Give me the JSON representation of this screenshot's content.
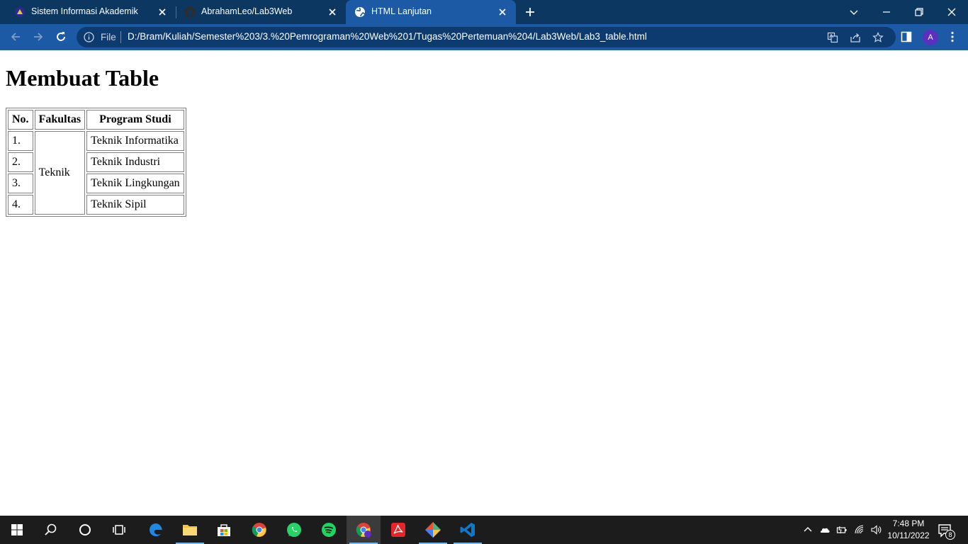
{
  "browser": {
    "tabs": [
      {
        "title": "Sistem Informasi Akademik",
        "active": false
      },
      {
        "title": "AbrahamLeo/Lab3Web",
        "active": false
      },
      {
        "title": "HTML Lanjutan",
        "active": true
      }
    ],
    "address": {
      "scheme_label": "File",
      "url": "D:/Bram/Kuliah/Semester%203/3.%20Pemrograman%20Web%201/Tugas%20Pertemuan%204/Lab3Web/Lab3_table.html"
    },
    "profile_initial": "A",
    "colors": {
      "tabstrip": "#0c3761",
      "toolbar": "#1d5aa6",
      "omnibox": "#0d3b70"
    }
  },
  "page": {
    "heading": "Membuat Table",
    "table": {
      "headers": [
        "No.",
        "Fakultas",
        "Program Studi"
      ],
      "faculty": "Teknik",
      "rows": [
        {
          "no": "1.",
          "program": "Teknik Informatika"
        },
        {
          "no": "2.",
          "program": "Teknik Industri"
        },
        {
          "no": "3.",
          "program": "Teknik Lingkungan"
        },
        {
          "no": "4.",
          "program": "Teknik Sipil"
        }
      ]
    }
  },
  "taskbar": {
    "apps": [
      "start-icon",
      "search-icon",
      "cortana-icon",
      "task-view-icon",
      "edge-icon",
      "file-explorer-icon",
      "store-icon",
      "chrome-icon",
      "whatsapp-icon",
      "spotify-icon",
      "chrome-profile-icon",
      "acrobat-icon",
      "git-icon",
      "vscode-icon"
    ],
    "clock": {
      "time": "7:48 PM",
      "date": "10/11/2022"
    },
    "notification_count": "8"
  }
}
